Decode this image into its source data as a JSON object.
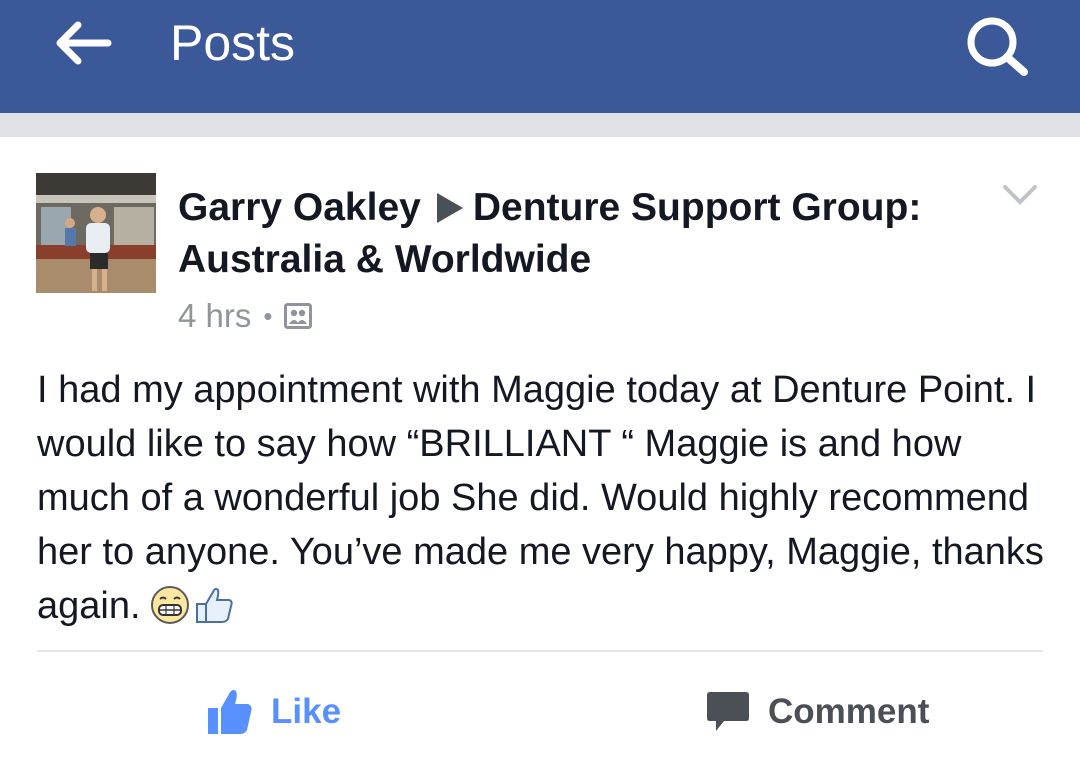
{
  "header": {
    "title": "Posts",
    "back_icon": "back-arrow-icon",
    "search_icon": "search-icon",
    "background_color": "#3b5998"
  },
  "post": {
    "author": "Garry Oakley",
    "group": "Denture Support Group: Australia & Worldwide",
    "time": "4 hrs",
    "separator": "•",
    "audience_icon": "group-audience-icon",
    "menu_icon": "chevron-down-icon",
    "body": "I had my appointment with Maggie today at Denture Point. I would like to say how “BRILLIANT “ Maggie is and how much of a wonderful job She did. Would highly recommend her to anyone. You’ve made me very happy, Maggie, thanks again.",
    "emojis": [
      "grinning-face-icon",
      "thumbs-up-icon"
    ]
  },
  "actions": {
    "like_label": "Like",
    "comment_label": "Comment",
    "like_color": "#5890ff"
  }
}
